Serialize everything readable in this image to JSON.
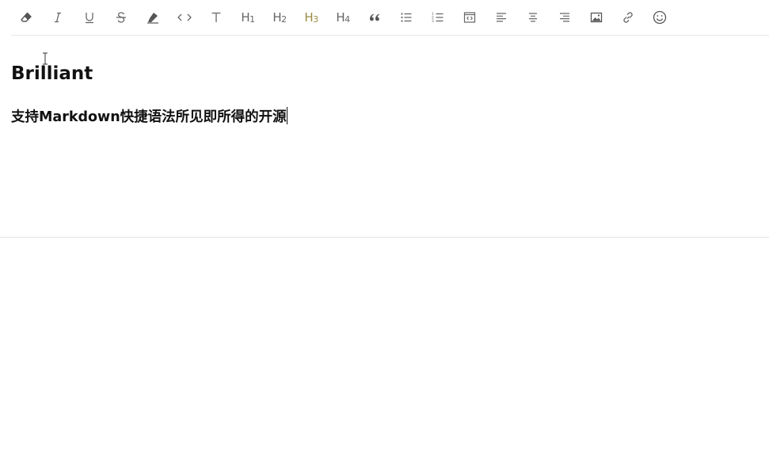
{
  "toolbar": {
    "buttons": [
      {
        "name": "clear-format-button",
        "icon": "eraser-icon"
      },
      {
        "name": "italic-button",
        "icon": "italic-icon"
      },
      {
        "name": "underline-button",
        "icon": "underline-icon"
      },
      {
        "name": "strikethrough-button",
        "icon": "strikethrough-icon"
      },
      {
        "name": "highlight-button",
        "icon": "highlighter-icon"
      },
      {
        "name": "inline-code-button",
        "icon": "code-icon"
      },
      {
        "name": "text-button",
        "icon": "text-t-icon"
      },
      {
        "name": "heading1-button",
        "label": "H",
        "sub": "1"
      },
      {
        "name": "heading2-button",
        "label": "H",
        "sub": "2"
      },
      {
        "name": "heading3-button",
        "label": "H",
        "sub": "3",
        "active": true
      },
      {
        "name": "heading4-button",
        "label": "H",
        "sub": "4"
      },
      {
        "name": "blockquote-button",
        "icon": "quote-icon"
      },
      {
        "name": "bullet-list-button",
        "icon": "bullet-list-icon"
      },
      {
        "name": "ordered-list-button",
        "icon": "ordered-list-icon"
      },
      {
        "name": "code-block-button",
        "icon": "code-block-icon"
      },
      {
        "name": "align-left-button",
        "icon": "align-left-icon"
      },
      {
        "name": "align-center-button",
        "icon": "align-center-icon"
      },
      {
        "name": "align-right-button",
        "icon": "align-right-icon"
      },
      {
        "name": "image-button",
        "icon": "image-icon"
      },
      {
        "name": "link-button",
        "icon": "link-icon"
      },
      {
        "name": "emoji-button",
        "icon": "smiley-icon"
      }
    ],
    "active_color": "#9b8a45",
    "icon_color": "#666666"
  },
  "document": {
    "heading2": "Brilliant",
    "heading3": "支持Markdown快捷语法所见即所得的开源"
  }
}
